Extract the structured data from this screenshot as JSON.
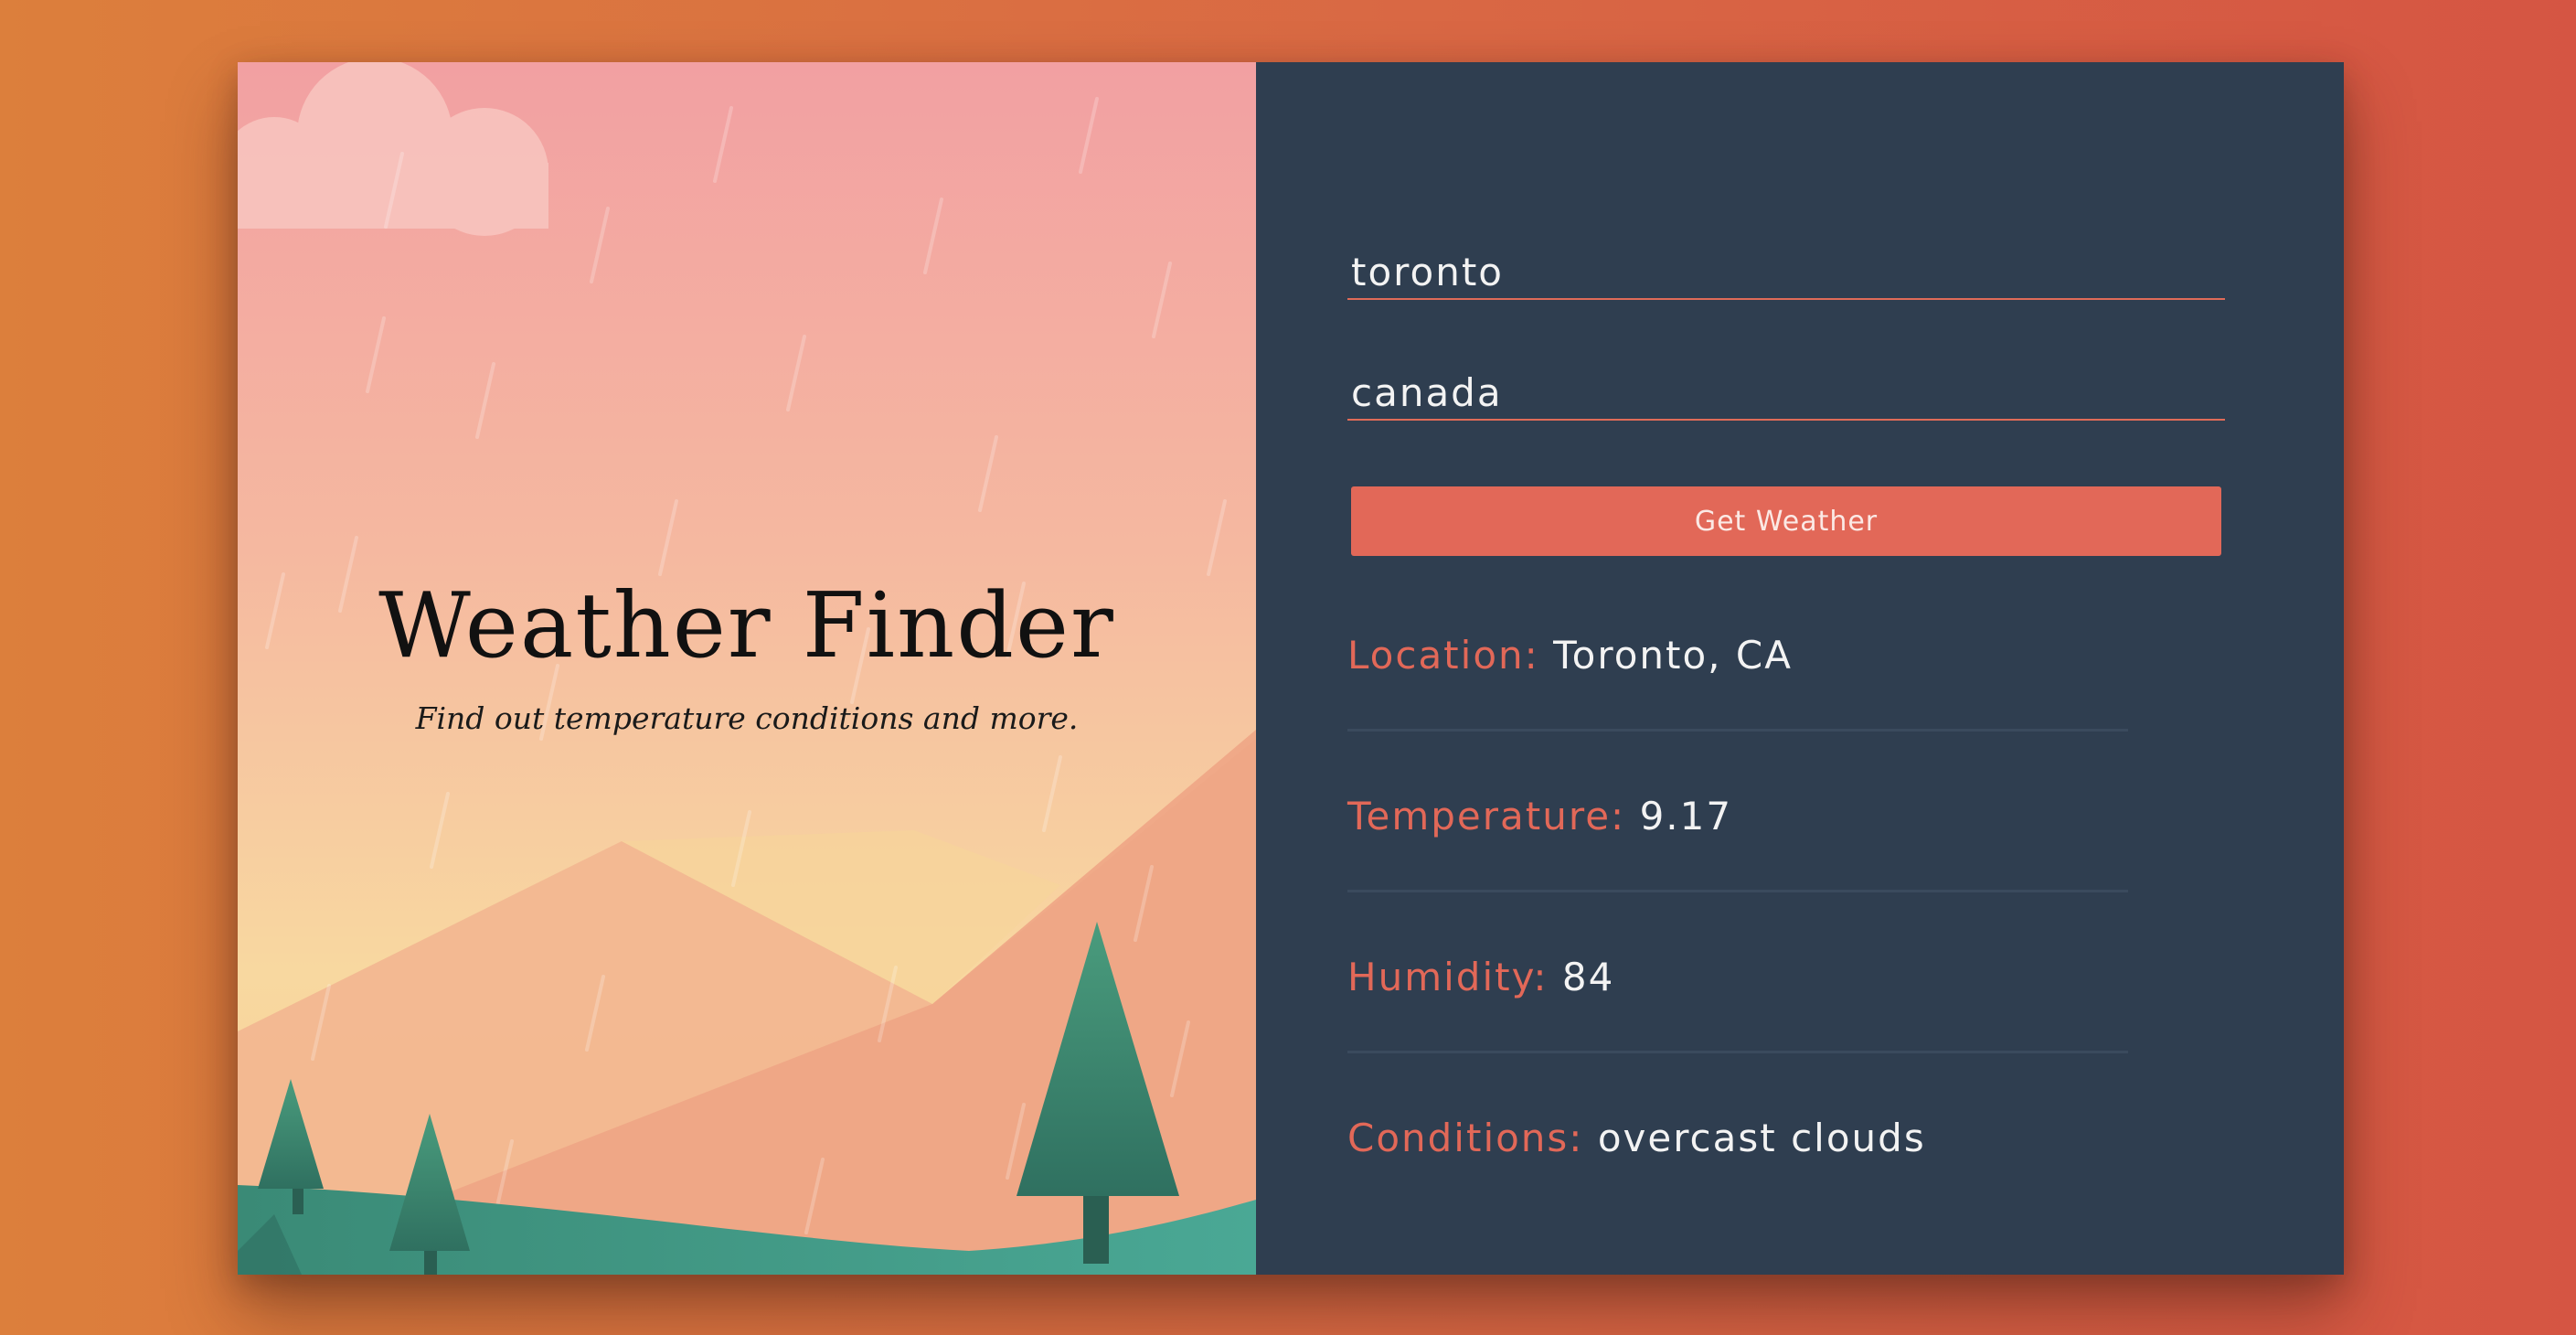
{
  "app": {
    "title": "Weather Finder",
    "subtitle": "Find out temperature conditions and more."
  },
  "form": {
    "city_value": "toronto",
    "country_value": "canada",
    "submit_label": "Get Weather"
  },
  "results": [
    {
      "label": "Location:",
      "value": "Toronto, CA"
    },
    {
      "label": "Temperature:",
      "value": "9.17"
    },
    {
      "label": "Humidity:",
      "value": "84"
    },
    {
      "label": "Conditions:",
      "value": "overcast clouds"
    }
  ],
  "colors": {
    "accent": "#e26858",
    "panel": "#2f3e50",
    "tree": "#3f8c74"
  }
}
